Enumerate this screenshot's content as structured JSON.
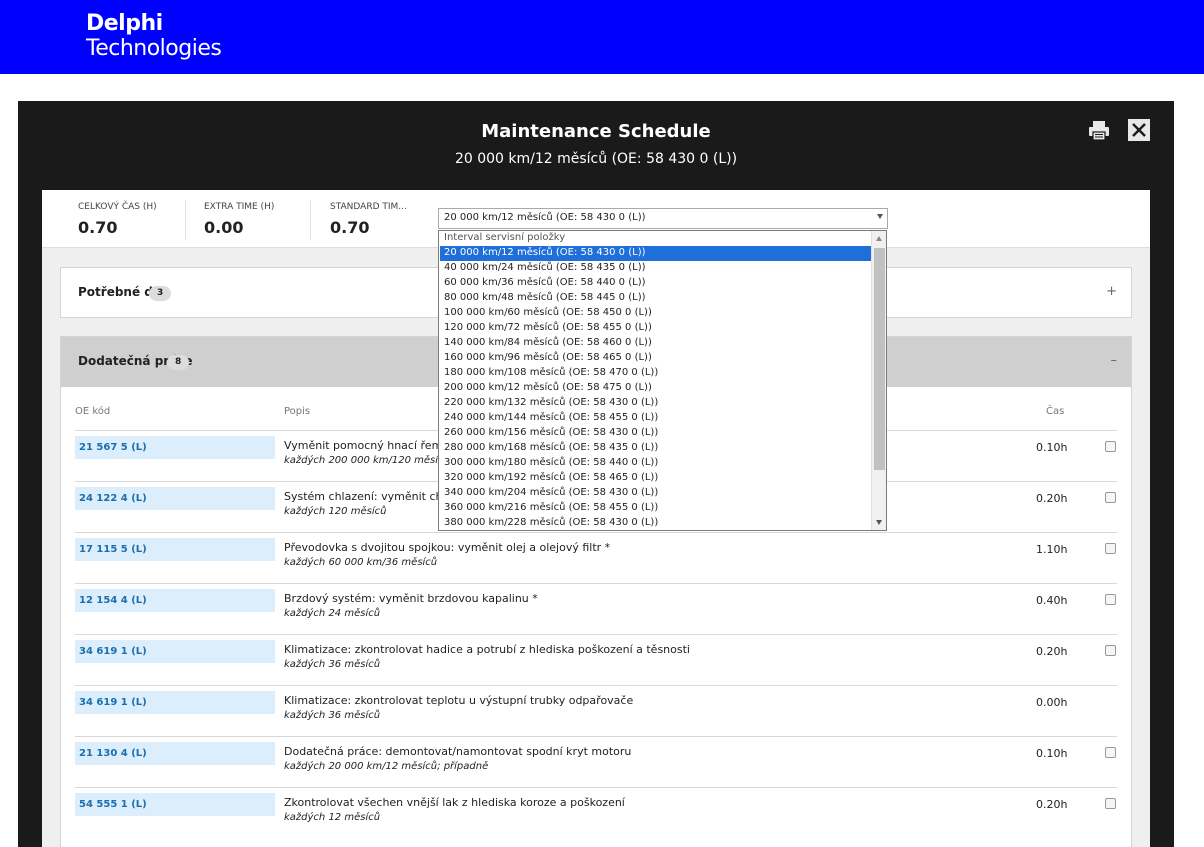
{
  "brand": {
    "line1": "Delphi",
    "line2": "Technologies",
    "bar_color": "#0000ff"
  },
  "modal": {
    "title": "Maintenance Schedule",
    "subtitle": "20 000 km/12 měsíců (OE: 58 430 0 (L))",
    "print_icon": "printer-icon",
    "close_icon": "close-icon"
  },
  "summary": {
    "total_label": "CELKOVÝ ČAS (H)",
    "total_value": "0.70",
    "extra_label": "EXTRA TIME (H)",
    "extra_value": "0.00",
    "standard_label": "STANDARD TIM...",
    "standard_value": "0.70"
  },
  "interval_select": {
    "value": "20 000 km/12 měsíců (OE: 58 430 0 (L))",
    "options_header": "Interval servisní položky",
    "options": [
      "20 000 km/12 měsíců (OE: 58 430 0 (L))",
      "40 000 km/24 měsíců (OE: 58 435 0 (L))",
      "60 000 km/36 měsíců (OE: 58 440 0 (L))",
      "80 000 km/48 měsíců (OE: 58 445 0 (L))",
      "100 000 km/60 měsíců (OE: 58 450 0 (L))",
      "120 000 km/72 měsíců (OE: 58 455 0 (L))",
      "140 000 km/84 měsíců (OE: 58 460 0 (L))",
      "160 000 km/96 měsíců (OE: 58 465 0 (L))",
      "180 000 km/108 měsíců (OE: 58 470 0 (L))",
      "200 000 km/12 měsíců (OE: 58 475 0 (L))",
      "220 000 km/132 měsíců (OE: 58 430 0 (L))",
      "240 000 km/144 měsíců (OE: 58 455 0 (L))",
      "260 000 km/156 měsíců (OE: 58 430 0 (L))",
      "280 000 km/168 měsíců (OE: 58 435 0 (L))",
      "300 000 km/180 měsíců (OE: 58 440 0 (L))",
      "320 000 km/192 měsíců (OE: 58 465 0 (L))",
      "340 000 km/204 měsíců (OE: 58 430 0 (L))",
      "360 000 km/216 měsíců (OE: 58 455 0 (L))",
      "380 000 km/228 měsíců (OE: 58 430 0 (L))"
    ],
    "selected_index": 0,
    "selected_color": "#1e6fd9"
  },
  "parts_panel": {
    "title": "Potřebné díly",
    "count": "3",
    "toggle": "+"
  },
  "work_panel": {
    "title": "Dodatečná práce",
    "count": "8",
    "toggle": "–",
    "col_code": "OE kód",
    "col_desc": "Popis",
    "col_time": "Čas",
    "rows": [
      {
        "code": "21 567 5 (L)",
        "desc": "Vyměnit pomocný hnací řemen",
        "sub": "každých 200 000 km/120 měsíců",
        "time": "0.10h",
        "checkbox": true
      },
      {
        "code": "24 122 4 (L)",
        "desc": "Systém chlazení: vyměnit chlad",
        "sub": "každých 120 měsíců",
        "time": "0.20h",
        "checkbox": true
      },
      {
        "code": "17 115 5 (L)",
        "desc": "Převodovka s dvojitou spojkou: vyměnit olej a olejový filtr *",
        "sub": "každých 60 000 km/36 měsíců",
        "time": "1.10h",
        "checkbox": true
      },
      {
        "code": "12 154 4 (L)",
        "desc": "Brzdový systém: vyměnit brzdovou kapalinu *",
        "sub": "každých 24 měsíců",
        "time": "0.40h",
        "checkbox": true
      },
      {
        "code": "34 619 1 (L)",
        "desc": "Klimatizace: zkontrolovat hadice a potrubí z hlediska poškození a těsnosti",
        "sub": "každých 36 měsíců",
        "time": "0.20h",
        "checkbox": true
      },
      {
        "code": "34 619 1 (L)",
        "desc": "Klimatizace: zkontrolovat teplotu u výstupní trubky odpařovače",
        "sub": "každých 36 měsíců",
        "time": "0.00h",
        "checkbox": false
      },
      {
        "code": "21 130 4 (L)",
        "desc": "Dodatečná práce: demontovat/namontovat spodní kryt motoru",
        "sub": "každých 20 000 km/12 měsíců; případně",
        "time": "0.10h",
        "checkbox": true
      },
      {
        "code": "54 555 1 (L)",
        "desc": "Zkontrolovat všechen vnější lak z hlediska koroze a poškození",
        "sub": "každých 12 měsíců",
        "time": "0.20h",
        "checkbox": true
      }
    ]
  }
}
